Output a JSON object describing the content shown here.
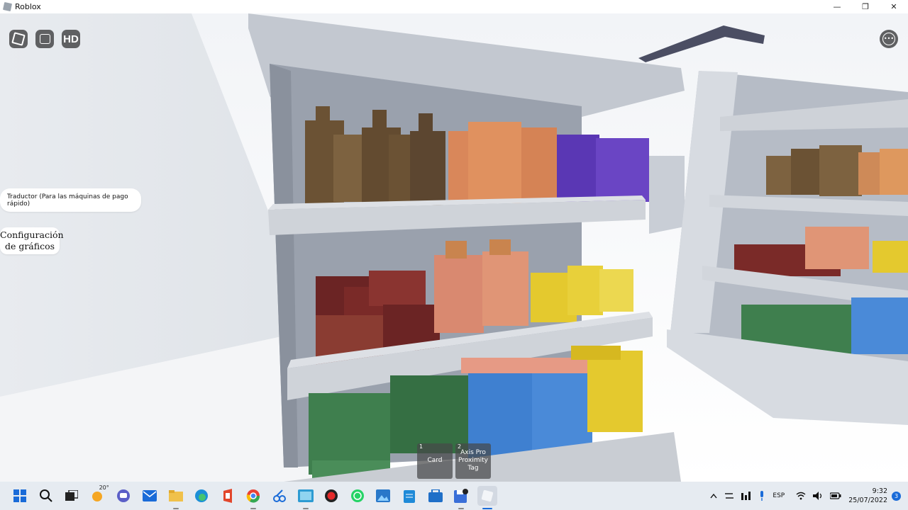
{
  "window": {
    "title": "Roblox",
    "minimize_glyph": "—",
    "restore_glyph": "❐",
    "close_glyph": "✕"
  },
  "hud": {
    "hd_label": "HD",
    "translator_label": "Traductor (Para las máquinas de pago rápido)",
    "graphics_line1": "Configuración",
    "graphics_line2": "de gráficos"
  },
  "hotbar": [
    {
      "slot": "1",
      "label": "Card"
    },
    {
      "slot": "2",
      "label_line1": "Axis Pro",
      "label_line2": "Proximity",
      "label_line3": "Tag"
    }
  ],
  "taskbar": {
    "weather_temp": "20°",
    "icons": [
      "windows-start-icon",
      "search-icon",
      "task-view-icon",
      "weather-icon",
      "teams-chat-icon",
      "mail-icon",
      "file-explorer-icon",
      "edge-icon",
      "office-icon",
      "chrome-icon",
      "snipping-tool-icon",
      "screen-recorder-icon",
      "record-icon",
      "whatsapp-icon",
      "photos-icon",
      "notepad-icon",
      "microsoft-store-icon",
      "save-icon",
      "roblox-icon"
    ]
  },
  "tray": {
    "language": "ESP",
    "time": "9:32",
    "date": "25/07/2022",
    "notification_count": "3"
  },
  "colors": {
    "shelf": "#c9cdd3",
    "brown": "#6b5234",
    "orange": "#d9875a",
    "purple": "#5a37b4",
    "red": "#7a2a28",
    "salmon": "#d98970",
    "yellow": "#e4c92e",
    "green": "#3f7f4e",
    "blue": "#3f80d0",
    "taskbar": "#e6ebf1",
    "accent": "#1a6bd8"
  }
}
